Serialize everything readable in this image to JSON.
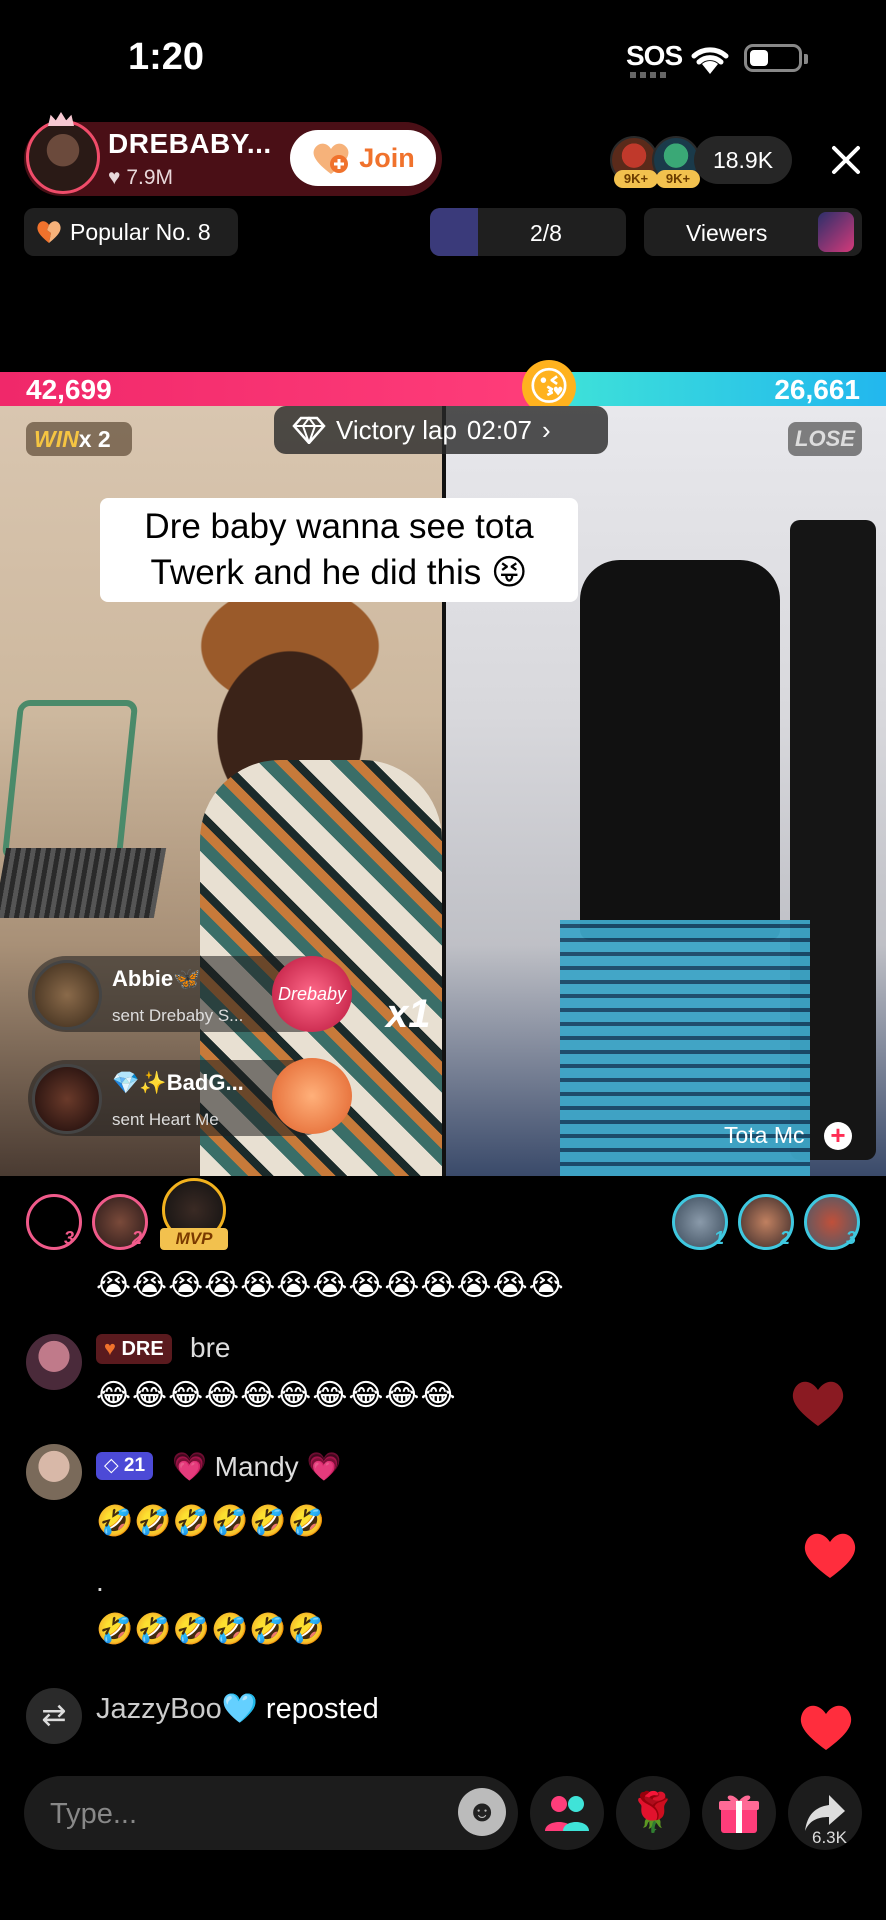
{
  "status_bar": {
    "time": "1:20",
    "sos": "SOS"
  },
  "host": {
    "name": "DREBABY...",
    "likes": "7.9M",
    "join_label": "Join"
  },
  "viewers": {
    "badge_1": "9K+",
    "badge_2": "9K+",
    "count": "18.9K"
  },
  "row2": {
    "popular": "Popular No. 8",
    "ranking": "2/8",
    "viewers_label": "Viewers"
  },
  "battle": {
    "left_score": "42,699",
    "right_score": "26,661",
    "left_share": 0.62,
    "win_word": "WIN",
    "win_count": "x 2",
    "lose_label": "LOSE",
    "victory_label": "Victory lap",
    "victory_timer": "02:07"
  },
  "caption": {
    "line1": "Dre baby wanna see tota",
    "line2": "Twerk and he did this 😝"
  },
  "gifts": [
    {
      "name": "Abbie🦋",
      "sub": "sent Drebaby S...",
      "multiplier": "x1",
      "gift_text": "Drebaby"
    },
    {
      "name": "💎✨BadG...",
      "sub": "sent Heart Me"
    }
  ],
  "opponent": {
    "name": "Tota Mc"
  },
  "rank_row": {
    "left": [
      {
        "num": "3"
      },
      {
        "num": "2"
      }
    ],
    "mvp": "MVP",
    "right": [
      {
        "num": "1"
      },
      {
        "num": "2"
      },
      {
        "num": "3"
      }
    ]
  },
  "comments": {
    "top_emojis": "😭😭😭😭😭😭😭😭😭😭😭😭😭",
    "c1": {
      "tag": "DRE",
      "name": "bre",
      "message": "😂😂😂😂😂😂😂😂😂😂"
    },
    "c2": {
      "level": "21",
      "name": "💗 Mandy 💗",
      "message1": "🤣🤣🤣🤣🤣🤣",
      "dot": ".",
      "message2": "🤣🤣🤣🤣🤣🤣"
    },
    "repost": {
      "user": "JazzyBoo🩵",
      "action": "reposted"
    }
  },
  "bottom": {
    "placeholder": "Type...",
    "share_count": "6.3K"
  },
  "colors": {
    "battle_left": "#f0286a",
    "battle_right": "#22b7ee",
    "heart": "#ff2d3d"
  },
  "icons": [
    "wifi-icon",
    "battery-icon",
    "close-icon",
    "heart-icon",
    "diamond-icon",
    "chevron-right-icon",
    "plus-icon",
    "repost-icon",
    "emoji-icon",
    "people-icon",
    "rose-icon",
    "gift-icon",
    "share-icon"
  ]
}
